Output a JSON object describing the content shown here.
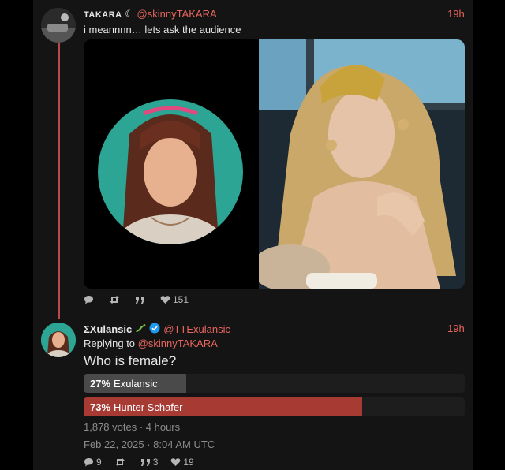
{
  "tweet1": {
    "display_name": "TAKARA",
    "moon_glyph": "☾",
    "handle": "@skinnyTAKARA",
    "time": "19h",
    "text": "i meannnn… lets ask the audience",
    "stats": {
      "replies": "",
      "retweets": "",
      "quotes": "",
      "likes": "151"
    }
  },
  "tweet2": {
    "display_name": "ΣXulansic",
    "handle": "@TTExulansic",
    "time": "19h",
    "replying_prefix": "Replying to",
    "replying_handle": "@skinnyTAKARA",
    "text": "Who is female?",
    "poll": [
      {
        "percent_label": "27%",
        "option": "Exulansic",
        "fraction": 0.27,
        "color": "#4a4a4a"
      },
      {
        "percent_label": "73%",
        "option": "Hunter Schafer",
        "fraction": 0.73,
        "color": "#a83a34"
      }
    ],
    "votes": "1,878 votes · 4 hours",
    "date": "Feb 22, 2025 · 8:04 AM UTC",
    "stats": {
      "replies": "9",
      "retweets": "",
      "quotes": "3",
      "likes": "19"
    }
  },
  "colors": {
    "accent": "#e8665e",
    "thread_line": "#b84a4a",
    "verified": "#1d9bf0"
  },
  "icons": [
    "reply-icon",
    "retweet-icon",
    "quote-icon",
    "heart-icon",
    "verified-icon",
    "lizard-emoji-icon"
  ]
}
